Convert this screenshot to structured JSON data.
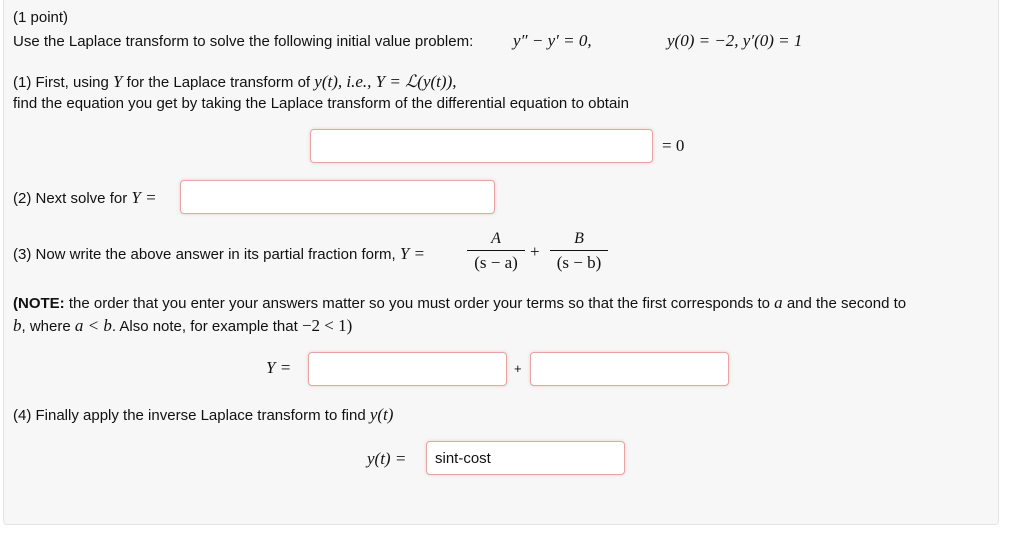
{
  "problem": {
    "points": "(1 point)",
    "intro": "Use the Laplace transform to solve the following initial value problem:",
    "ode": "y″ − y′ = 0,",
    "initial_conditions": "y(0) = −2,  y′(0) = 1"
  },
  "part1": {
    "line1_prefix": "(1) First, using",
    "line1_var": "Y",
    "line1_mid": "for the Laplace transform of",
    "line1_math": "y(t), i.e., Y = ℒ(y(t)),",
    "line2": "find the equation you get by taking the Laplace transform of the differential equation to obtain",
    "answer_value": "",
    "equals_zero": "= 0"
  },
  "part2": {
    "prefix": "(2) Next solve for",
    "math": "Y =",
    "answer_value": ""
  },
  "part3": {
    "prefix": "(3) Now write the above answer in its partial fraction form,",
    "math": "Y =",
    "frac1_num": "A",
    "frac1_den": "(s − a)",
    "plus": "+",
    "frac2_num": "B",
    "frac2_den": "(s − b)"
  },
  "note": {
    "bold": "(NOTE:",
    "text1": " the order that you enter your answers matter so you must order your terms so that the first corresponds to ",
    "a": "a",
    "text2": " and the second to",
    "b": "b",
    "text3": ", where ",
    "ineq": "a < b",
    "text4": ". Also note, for example that ",
    "example": "−2 < 1)"
  },
  "part3_inputs": {
    "label": "Y =",
    "plus": "+",
    "answer1_value": "",
    "answer2_value": ""
  },
  "part4": {
    "prefix": "(4) Finally apply the inverse Laplace transform to find",
    "math": "y(t)",
    "label": "y(t) =",
    "answer_value": "sint-cost"
  }
}
